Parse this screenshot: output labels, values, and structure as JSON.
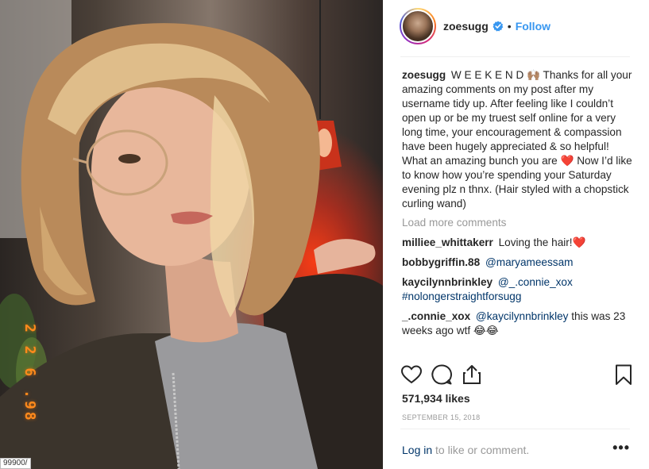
{
  "post": {
    "date_stamp": "2 2 6 .98",
    "corner_tag": "99900/",
    "author": {
      "username": "zoesugg",
      "verified_icon": "verified-badge-icon",
      "separator": "•",
      "follow_label": "Follow"
    },
    "caption": {
      "username": "zoesugg",
      "text": "W E E K E N D 🙌🏽 Thanks for all your amazing comments on my post after my username tidy up. After feeling like I couldn’t open up or be my truest self online for a very long time, your encouragement & compassion have been hugely appreciated & so helpful! What an amazing bunch you are ❤️ Now I’d like to know how you’re spending your Saturday evening plz n thnx. (Hair styled with a chopstick curling wand)"
    },
    "load_more_label": "Load more comments",
    "comments": [
      {
        "username": "milliee_whittakerr",
        "mention": "",
        "text": "Loving the hair!❤️"
      },
      {
        "username": "bobbygriffin.88",
        "mention": "@maryameessam",
        "text": ""
      },
      {
        "username": "kaycilynnbrinkley",
        "mention": "@_.connie_xox",
        "text": "#nolongerstraightforsugg"
      },
      {
        "username": "_.connie_xox",
        "mention": "@kaycilynnbrinkley",
        "text": "this was 23 weeks ago wtf 😂😂"
      }
    ],
    "actions": {
      "like_icon": "heart-icon",
      "comment_icon": "comment-bubble-icon",
      "share_icon": "share-upload-icon",
      "save_icon": "bookmark-icon"
    },
    "likes": "571,934 likes",
    "timestamp": "SEPTEMBER 15, 2018",
    "footer": {
      "login_label": "Log in",
      "suffix": " to like or comment.",
      "more_label": "•••"
    }
  }
}
